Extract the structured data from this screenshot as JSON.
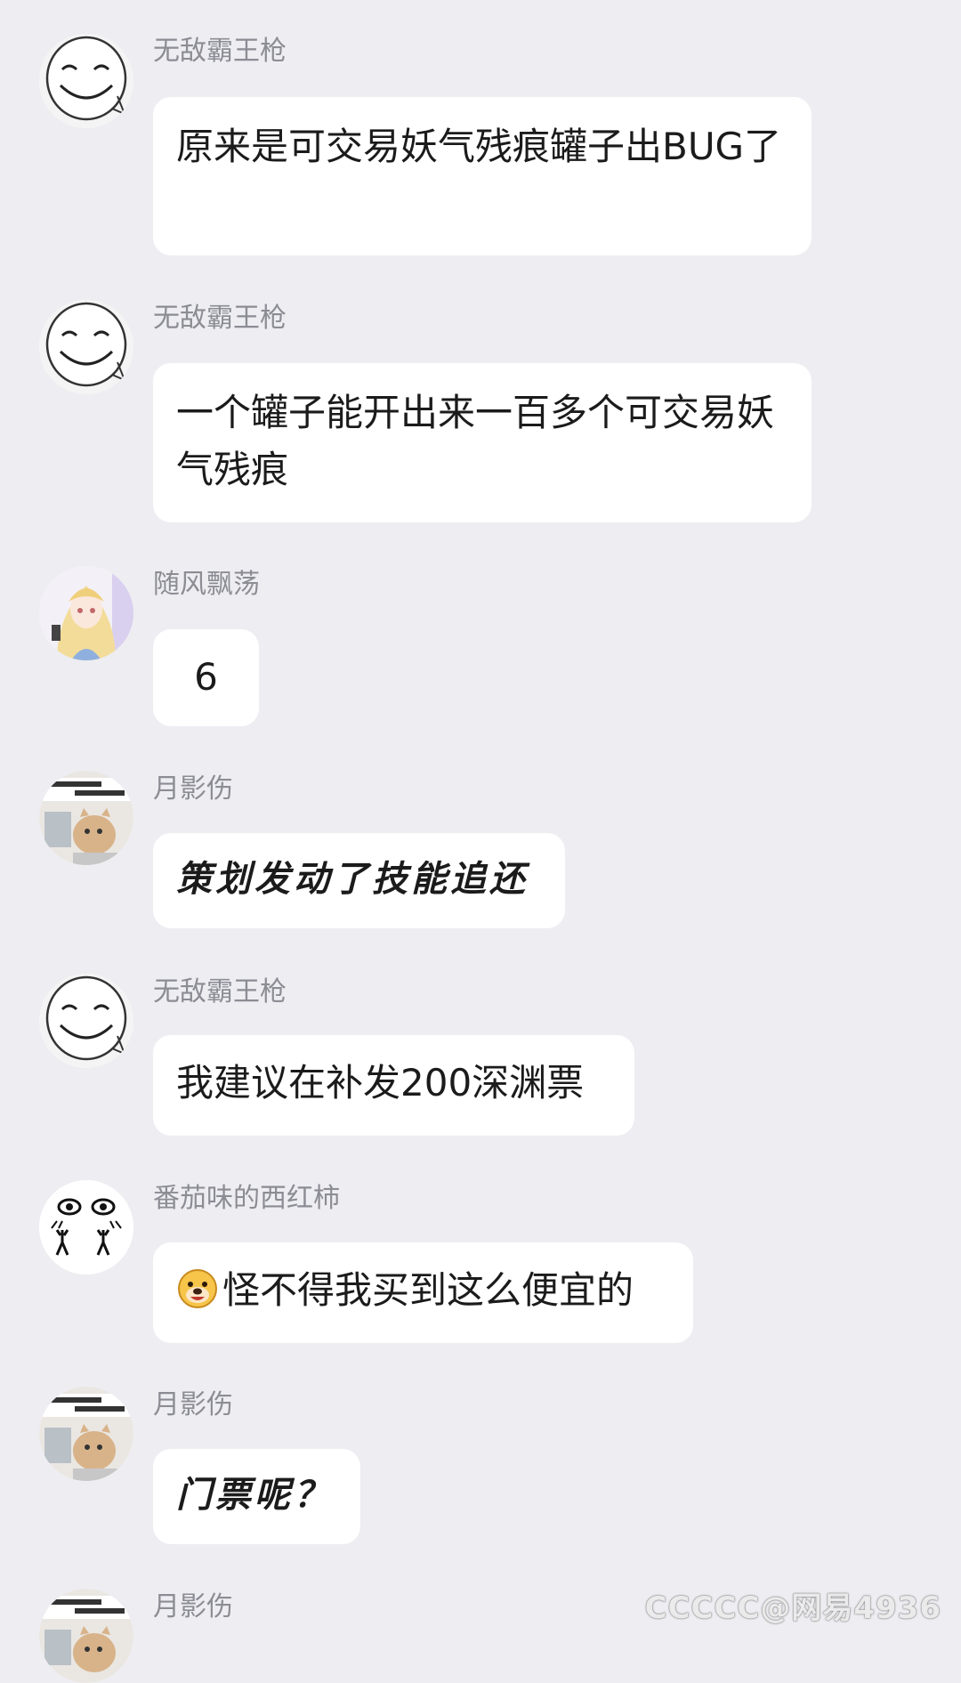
{
  "messages": [
    {
      "sender": "无敌霸王枪",
      "text": "原来是可交易妖气残痕罐子出BUG了",
      "avatar": "smiley-face-icon"
    },
    {
      "sender": "无敌霸王枪",
      "text": "一个罐子能开出来一百多个可交易妖气残痕",
      "avatar": "smiley-face-icon"
    },
    {
      "sender": "随风飘荡",
      "text": "6",
      "avatar": "anime-girl-icon"
    },
    {
      "sender": "月影伤",
      "text": "策划发动了技能追还",
      "avatar": "cat-at-computer-icon"
    },
    {
      "sender": "无敌霸王枪",
      "text": "我建议在补发200深渊票",
      "avatar": "smiley-face-icon"
    },
    {
      "sender": "番茄味的西红柿",
      "text": "怪不得我买到这么便宜的",
      "avatar": "doodle-face-icon",
      "emoji": "grinning-dog-emoji-icon"
    },
    {
      "sender": "月影伤",
      "text": "门票呢？",
      "avatar": "cat-at-computer-icon"
    },
    {
      "sender": "月影伤",
      "text": "",
      "avatar": "cat-at-computer-icon"
    }
  ],
  "watermark": "CCCCC@网易4936",
  "colors": {
    "background": "#ededf2",
    "bubble": "#ffffff",
    "sender_name": "#8c8c94",
    "message_text": "#1b1b1b"
  }
}
